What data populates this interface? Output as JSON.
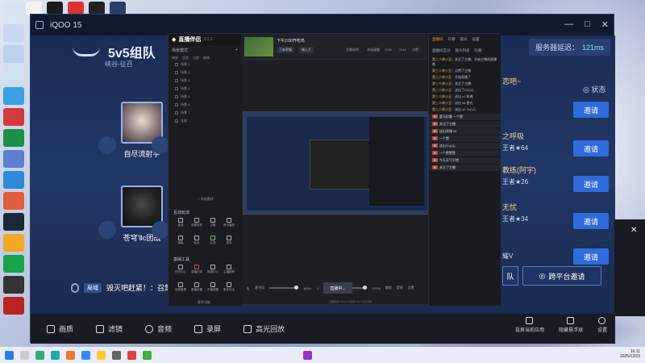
{
  "app": {
    "title": "iQOO 15",
    "controls": [
      "—",
      "□",
      "✕"
    ]
  },
  "game": {
    "mode": "5v5组队",
    "submode": "峡谷-征召",
    "ping_label": "服务器延迟：",
    "ping_value": "121ms",
    "status_label": "状态",
    "players": [
      {
        "name": "自尽流射手"
      },
      {
        "name": "苍穹'Ⅱc团战"
      }
    ],
    "player_partial": "好",
    "tip_badge": "局域",
    "tip_text": "毁灭吧赶紧！：召集",
    "friends": [
      {
        "name": "恋吧~",
        "rank": "",
        "invite": "邀请"
      },
      {
        "name": "之呼吸",
        "rank": "王者★64",
        "invite": "邀请"
      },
      {
        "name": "教练(阿宇)",
        "rank": "王者★26",
        "invite": "邀请"
      },
      {
        "name": "无忧",
        "rank": "王者★34",
        "invite": "邀请"
      },
      {
        "name": "",
        "rank": "耀V",
        "invite": "邀请"
      }
    ],
    "cross_left": "队",
    "cross_platform": "跨平台邀请"
  },
  "toolbar": {
    "items": [
      {
        "label": "画质"
      },
      {
        "label": "滤镜"
      },
      {
        "label": "音频"
      },
      {
        "label": "录屏"
      },
      {
        "label": "高光回放"
      }
    ],
    "right": [
      {
        "label": "投屏当前应用"
      },
      {
        "label": "隐藏悬浮球"
      },
      {
        "label": "设置"
      }
    ],
    "side_close": "✕"
  },
  "live": {
    "brand": "直播伴侣",
    "version": "2.0.0",
    "scene_header": "场景模式",
    "scene_tabs": [
      "横屏",
      "竖屏",
      "全部",
      "编辑"
    ],
    "scenes": [
      "场景 1",
      "场景 2",
      "场景 3",
      "场景 4",
      "场景 5",
      "场景 6",
      "场景 7",
      "全屏"
    ],
    "add_source": "+ 添加素材",
    "section_interactive": "互动玩法",
    "interactive_tools": [
      "连线",
      "观看特权",
      "点歌",
      "音乐播放",
      "弹幕",
      "贴纸",
      "礼物",
      "更多"
    ],
    "section_basic": "基础工具",
    "basic_tools": [
      "任务中心",
      "直播记录",
      "数据中心",
      "主播推荐",
      "连麦管理",
      "直播设置",
      "开播提醒",
      "更多玩法"
    ],
    "more_functions": "更多功能",
    "stream_title": "下午2:00开吃鸡",
    "tags": [
      "王者荣耀",
      "输入文"
    ],
    "stats": [
      "主播说明",
      "本场观看",
      "1782",
      "1144",
      "点赞"
    ],
    "mic_label": "麦克风",
    "mic_value": "100%",
    "speaker_label": "扬声器",
    "speaker_value": "100%",
    "bottom_tools": [
      "美颜",
      "音效",
      "设置"
    ],
    "start_button": "直播中...",
    "right_tabs": [
      "直播间",
      "礼物",
      "观众",
      "设置"
    ],
    "right_subtabs": [
      "直播间互动",
      "观众列表",
      "礼物"
    ],
    "chat": [
      {
        "user": "第三人称小丑",
        "text": "：关注了主播，开始主播的直播哦"
      },
      {
        "user": "第三人称小丑",
        "text": "：点赞了主播"
      },
      {
        "user": "第三人称小丑",
        "text": "：开始直播了"
      },
      {
        "user": "第三人称小丑",
        "text": "：关注了主播"
      },
      {
        "user": "第三人称小丑",
        "text": "：送出了小心心"
      },
      {
        "user": "第三人称小丑",
        "text": "：送出 x1 玫瑰"
      },
      {
        "user": "第三人称小丑",
        "text": "：送出 x6 星光"
      },
      {
        "user": "第三人称小丑",
        "text": "：送出 x2 小心心"
      }
    ],
    "gifts": [
      {
        "badge": "R",
        "text": "喜马拉雅 一个赞"
      },
      {
        "badge": "R",
        "text": "关注了主播"
      },
      {
        "badge": "R",
        "text": "送出玫瑰 x3"
      },
      {
        "badge": "R",
        "text": "一个赞"
      },
      {
        "badge": "R",
        "text": "送出小心心"
      },
      {
        "badge": "R",
        "text": "一个赞赞赞"
      },
      {
        "badge": "R",
        "text": "今天天气不错"
      },
      {
        "badge": "R",
        "text": "关注了主播"
      }
    ],
    "status_bar": "直播时长 01:23:45  码率 CPU 内存 帧率"
  },
  "taskbar": {
    "time": "16:11",
    "date": "2025/12/23"
  },
  "colors": {
    "invite_blue": "#2f6bdb",
    "rank_gold": "#f1d39a",
    "live_accent": "#ff8a3d"
  }
}
